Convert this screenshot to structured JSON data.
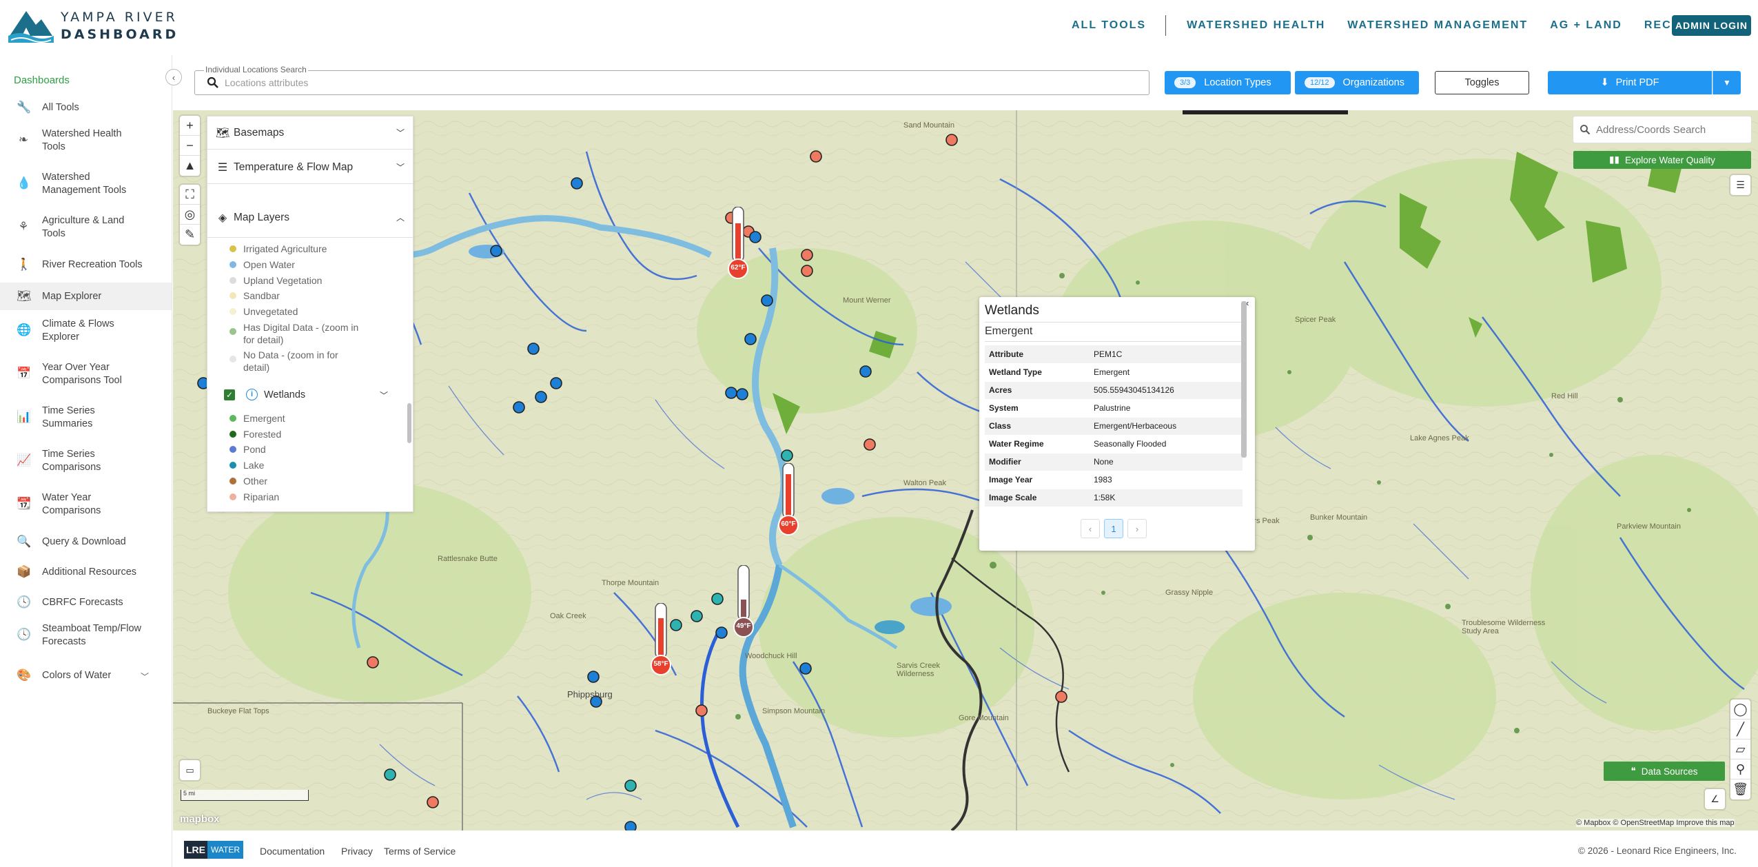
{
  "app": {
    "logo_line1": "YAMPA RIVER",
    "logo_line2": "DASHBOARD"
  },
  "topnav": {
    "items": [
      "ALL TOOLS",
      "WATERSHED HEALTH",
      "WATERSHED MANAGEMENT",
      "AG + LAND",
      "RECREATION"
    ],
    "admin_label": "ADMIN LOGIN"
  },
  "sidebar": {
    "title": "Dashboards",
    "items": [
      {
        "label": "All Tools",
        "icon": "wrench-icon"
      },
      {
        "label": "Watershed Health Tools",
        "icon": "leaf-icon"
      },
      {
        "label": "Watershed Management Tools",
        "icon": "droplet-icon"
      },
      {
        "label": "Agriculture & Land Tools",
        "icon": "plant-icon"
      },
      {
        "label": "River Recreation Tools",
        "icon": "hiker-icon"
      },
      {
        "label": "Map Explorer",
        "icon": "map-icon"
      },
      {
        "label": "Climate & Flows Explorer",
        "icon": "globe-icon"
      },
      {
        "label": "Year Over Year Comparisons Tool",
        "icon": "calendar-icon"
      },
      {
        "label": "Time Series Summaries",
        "icon": "bar-chart-icon"
      },
      {
        "label": "Time Series Comparisons",
        "icon": "line-chart-icon"
      },
      {
        "label": "Water Year Comparisons",
        "icon": "calendar-icon"
      },
      {
        "label": "Query & Download",
        "icon": "search-icon"
      },
      {
        "label": "Additional Resources",
        "icon": "box-icon"
      },
      {
        "label": "CBRFC Forecasts",
        "icon": "clock-icon"
      },
      {
        "label": "Steamboat Temp/Flow Forecasts",
        "icon": "clock-icon"
      },
      {
        "label": "Colors of Water",
        "icon": "palette-icon"
      }
    ]
  },
  "search": {
    "label": "Individual Locations Search",
    "placeholder": "Locations attributes"
  },
  "toolbar": {
    "location_types_count": "3/3",
    "location_types_label": "Location Types",
    "organizations_count": "12/12",
    "organizations_label": "Organizations",
    "toggles_label": "Toggles",
    "print_label": "Print PDF"
  },
  "layer_panel": {
    "basemaps_label": "Basemaps",
    "temp_flow_label": "Temperature & Flow Map",
    "map_layers_label": "Map Layers",
    "land_legend": [
      {
        "label": "Irrigated Agriculture",
        "color": "#d9c24a"
      },
      {
        "label": "Open Water",
        "color": "#7fb8e8"
      },
      {
        "label": "Upland Vegetation",
        "color": "#dcdcdc"
      },
      {
        "label": "Sandbar",
        "color": "#f3e9b6"
      },
      {
        "label": "Unvegetated",
        "color": "#f6f0cf"
      },
      {
        "label": "Has Digital Data - (zoom in for detail)",
        "color": "#9ac48a"
      },
      {
        "label": "No Data - (zoom in for detail)",
        "color": "#e6e6e6"
      }
    ],
    "wetlands_label": "Wetlands",
    "wetlands_legend": [
      {
        "label": "Emergent",
        "color": "#5cb85c"
      },
      {
        "label": "Forested",
        "color": "#1e6b1e"
      },
      {
        "label": "Pond",
        "color": "#5a7bd4"
      },
      {
        "label": "Lake",
        "color": "#1a8fb0"
      },
      {
        "label": "Other",
        "color": "#b0703a"
      },
      {
        "label": "Riparian",
        "color": "#f0b0a0"
      }
    ]
  },
  "popup": {
    "title": "Wetlands",
    "subtitle": "Emergent",
    "rows": [
      {
        "k": "Attribute",
        "v": "PEM1C"
      },
      {
        "k": "Wetland Type",
        "v": "Emergent"
      },
      {
        "k": "Acres",
        "v": "505.55943045134126"
      },
      {
        "k": "System",
        "v": "Palustrine"
      },
      {
        "k": "Class",
        "v": "Emergent/Herbaceous"
      },
      {
        "k": "Water Regime",
        "v": "Seasonally Flooded"
      },
      {
        "k": "Modifier",
        "v": "None"
      },
      {
        "k": "Image Year",
        "v": "1983"
      },
      {
        "k": "Image Scale",
        "v": "1:58K"
      }
    ],
    "page": "1"
  },
  "map": {
    "address_placeholder": "Address/Coords Search",
    "explore_label": "Explore Water Quality",
    "data_sources_label": "Data Sources",
    "scale_label": "5 mi",
    "mapbox_label": "mapbox",
    "attribution": "© Mapbox © OpenStreetMap  Improve this map",
    "thermometers": [
      {
        "label": "62°F",
        "color": "#e8402c"
      },
      {
        "label": "60°F",
        "color": "#e8402c"
      },
      {
        "label": "49°F",
        "color": "#8a5252"
      },
      {
        "label": "58°F",
        "color": "#e8402c"
      }
    ],
    "place_labels": [
      "Sand Mountain",
      "Mount Werner",
      "Walton Peak",
      "Spicer Peak",
      "Red Hill",
      "Lake Agnes Peak",
      "Bunker Mountain",
      "Parkview Mountain",
      "Rattlesnake Butte",
      "Thorpe Mountain",
      "Oak Creek",
      "Phippsburg",
      "Woodchuck Hill",
      "Sarvis Creek Wilderness",
      "Simpson Mountain",
      "Gore Mountain",
      "Buckeye Flat Tops",
      "Rabbit Ears Peak",
      "Troublesome Wilderness Study Area",
      "Grassy Nipple"
    ]
  },
  "footer": {
    "logo_a": "LRE",
    "logo_b": "WATER",
    "links": [
      "Documentation",
      "Privacy",
      "Terms of Service"
    ],
    "copyright": "© 2026 - Leonard Rice Engineers, Inc."
  }
}
